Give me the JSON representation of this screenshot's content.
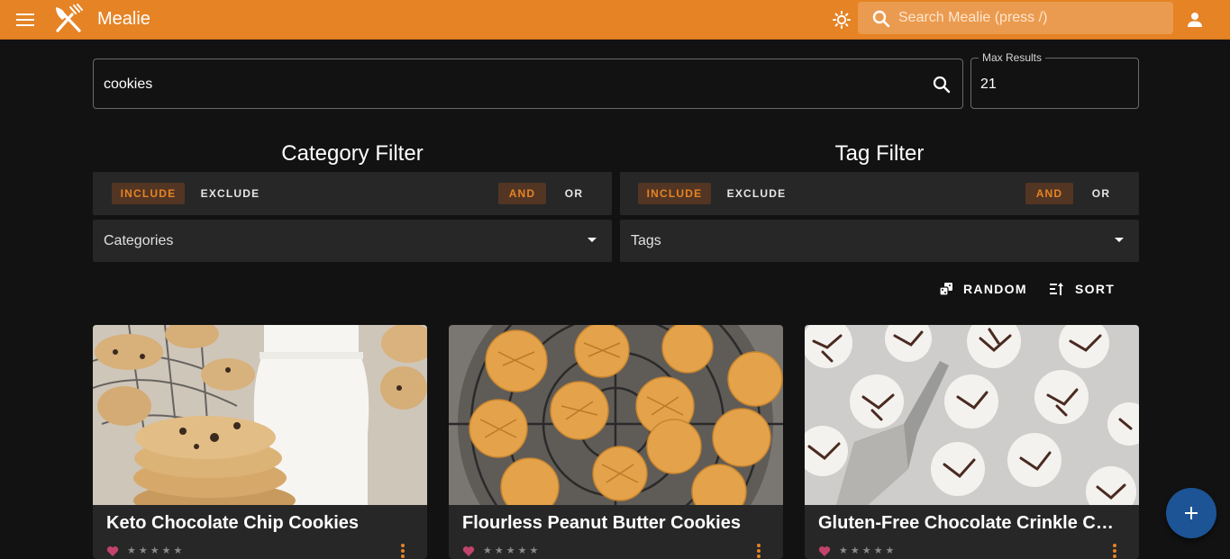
{
  "app": {
    "title": "Mealie",
    "accent": "#e58325",
    "search_placeholder": "Search Mealie (press /)"
  },
  "search": {
    "query": "cookies",
    "max_results_label": "Max Results",
    "max_results_value": "21"
  },
  "category_filter": {
    "title": "Category Filter",
    "include_label": "INCLUDE",
    "exclude_label": "EXCLUDE",
    "and_label": "AND",
    "or_label": "OR",
    "select_placeholder": "Categories"
  },
  "tag_filter": {
    "title": "Tag Filter",
    "include_label": "INCLUDE",
    "exclude_label": "EXCLUDE",
    "and_label": "AND",
    "or_label": "OR",
    "select_placeholder": "Tags"
  },
  "actions": {
    "random_label": "RANDOM",
    "sort_label": "SORT"
  },
  "recipes": [
    {
      "title": "Keto Chocolate Chip Cookies",
      "favorite": false,
      "rating": 0
    },
    {
      "title": "Flourless Peanut Butter Cookies",
      "favorite": false,
      "rating": 0
    },
    {
      "title": "Gluten-Free Chocolate Crinkle Cookies",
      "favorite": false,
      "rating": 0
    }
  ],
  "icons": {
    "menu": "menu-icon",
    "logo": "fork-knife-icon",
    "theme": "brightness-icon",
    "search": "search-icon",
    "user": "account-icon",
    "random": "dice-icon",
    "sort": "sort-icon",
    "heart": "heart-icon",
    "more": "dots-vertical-icon",
    "add": "plus-icon"
  }
}
